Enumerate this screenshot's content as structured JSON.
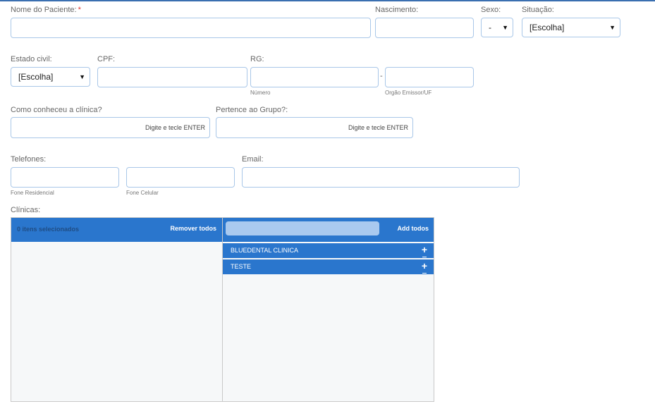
{
  "form": {
    "nome_label": "Nome do Paciente:",
    "required_mark": "*",
    "nascimento_label": "Nascimento:",
    "sexo_label": "Sexo:",
    "sexo_value": "-",
    "situacao_label": "Situação:",
    "situacao_value": "[Escolha]",
    "estado_civil_label": "Estado civil:",
    "estado_civil_value": "[Escolha]",
    "cpf_label": "CPF:",
    "rg_label": "RG:",
    "rg_dash": "-",
    "rg_numero_sub": "Número",
    "rg_orgao_sub": "Orgão Emissor/UF",
    "como_conheceu_label": "Como conheceu a clínica?",
    "como_conheceu_hint": "Digite e tecle ENTER",
    "grupo_label": "Pertence ao Grupo?:",
    "grupo_hint": "Digite e tecle ENTER",
    "telefones_label": "Telefones:",
    "fone_residencial_sub": "Fone Residencial",
    "fone_celular_sub": "Fone Celular",
    "email_label": "Email:",
    "clinicas_label": "Clínicas:"
  },
  "clinicas": {
    "selected_count": "0 itens selecionados",
    "remove_all": "Remover todos",
    "add_all": "Add todos",
    "available": [
      {
        "label": "BLUEDENTAL CLINICA"
      },
      {
        "label": "TESTE"
      }
    ],
    "item_icon": "plus-icon"
  },
  "colors": {
    "accent": "#2a76cd",
    "field_border": "#a9c7e8",
    "required": "#e0312b"
  }
}
